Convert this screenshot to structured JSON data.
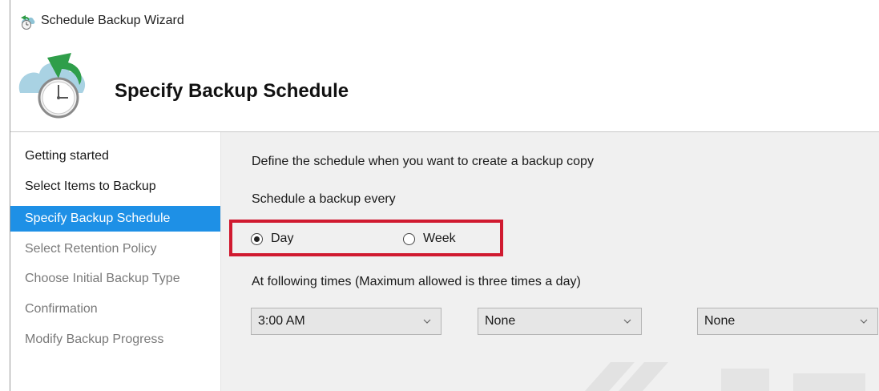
{
  "window": {
    "title": "Schedule Backup Wizard",
    "header_title": "Specify Backup Schedule"
  },
  "sidebar": {
    "items": [
      {
        "label": "Getting started",
        "state": "normal"
      },
      {
        "label": "Select Items to Backup",
        "state": "normal"
      },
      {
        "label": "Specify Backup Schedule",
        "state": "active"
      },
      {
        "label": "Select Retention Policy",
        "state": "disabled"
      },
      {
        "label": "Choose Initial Backup Type",
        "state": "disabled"
      },
      {
        "label": "Confirmation",
        "state": "disabled"
      },
      {
        "label": "Modify Backup Progress",
        "state": "disabled"
      }
    ]
  },
  "content": {
    "description": "Define the schedule when you want to create a backup copy",
    "schedule_label": "Schedule a backup every",
    "frequency": {
      "options": [
        {
          "label": "Day",
          "checked": true
        },
        {
          "label": "Week",
          "checked": false
        }
      ]
    },
    "times_label": "At following times (Maximum allowed is three times a day)",
    "time_selects": [
      {
        "value": "3:00 AM"
      },
      {
        "value": "None"
      },
      {
        "value": "None"
      }
    ]
  },
  "colors": {
    "active_nav": "#1e90e6",
    "highlight_border": "#d01a30",
    "content_bg": "#f0f0f0"
  },
  "icons": {
    "title_icon": "backup-wizard-icon",
    "header_icon": "cloud-clock-backup-icon",
    "dropdown_icon": "chevron-down-icon"
  }
}
